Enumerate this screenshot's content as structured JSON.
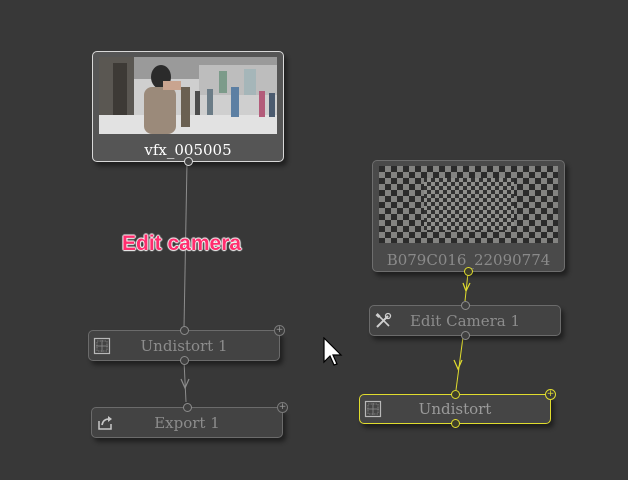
{
  "annotation": {
    "text": "Edit camera",
    "color": "#ff2d6e"
  },
  "colors": {
    "background": "#383838",
    "selected": "#e0dc2e",
    "wire": "#8c8c8c"
  },
  "nodes": {
    "source_1": {
      "title": "vfx_005005",
      "icon": "video-thumbnail"
    },
    "undistort_1": {
      "label": "Undistort 1",
      "icon": "grid-icon"
    },
    "export_1": {
      "label": "Export 1",
      "icon": "export-icon"
    },
    "source_2": {
      "title": "B079C016_22090774",
      "icon": "checkerboard-thumbnail"
    },
    "edit_camera_1": {
      "label": "Edit Camera 1",
      "icon": "tools-icon"
    },
    "undistort_2": {
      "label": "Undistort",
      "icon": "grid-icon",
      "selected": true
    }
  }
}
